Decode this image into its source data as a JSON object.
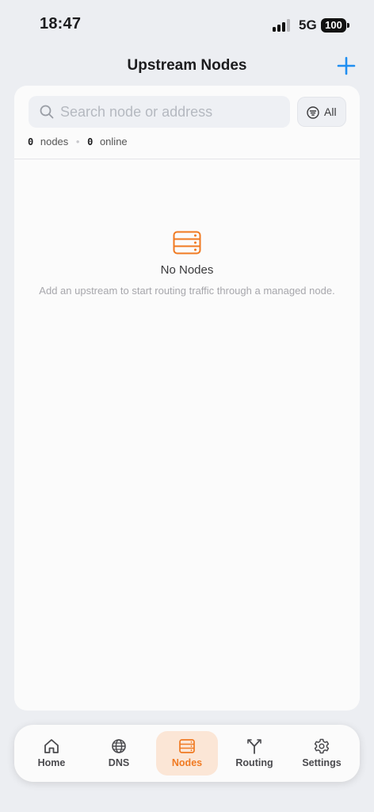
{
  "status": {
    "time": "18:47",
    "network": "5G",
    "battery": "100"
  },
  "header": {
    "title": "Upstream Nodes",
    "add_icon": "plus-icon"
  },
  "search": {
    "placeholder": "Search node or address",
    "value": ""
  },
  "filter": {
    "label": "All",
    "icon": "filter-icon"
  },
  "stats": {
    "nodes_count": "0",
    "nodes_label": "nodes",
    "online_count": "0",
    "online_label": "online"
  },
  "empty_state": {
    "icon": "server-icon",
    "title": "No Nodes",
    "description": "Add an upstream to start routing traffic through a managed node."
  },
  "tabs": [
    {
      "label": "Home",
      "icon": "home-icon",
      "active": false
    },
    {
      "label": "DNS",
      "icon": "globe-icon",
      "active": false
    },
    {
      "label": "Nodes",
      "icon": "server-icon",
      "active": true
    },
    {
      "label": "Routing",
      "icon": "routing-icon",
      "active": false
    },
    {
      "label": "Settings",
      "icon": "gear-icon",
      "active": false
    }
  ],
  "colors": {
    "accent": "#f07a22",
    "add_button": "#1f8ef1",
    "background": "#eceef2"
  }
}
